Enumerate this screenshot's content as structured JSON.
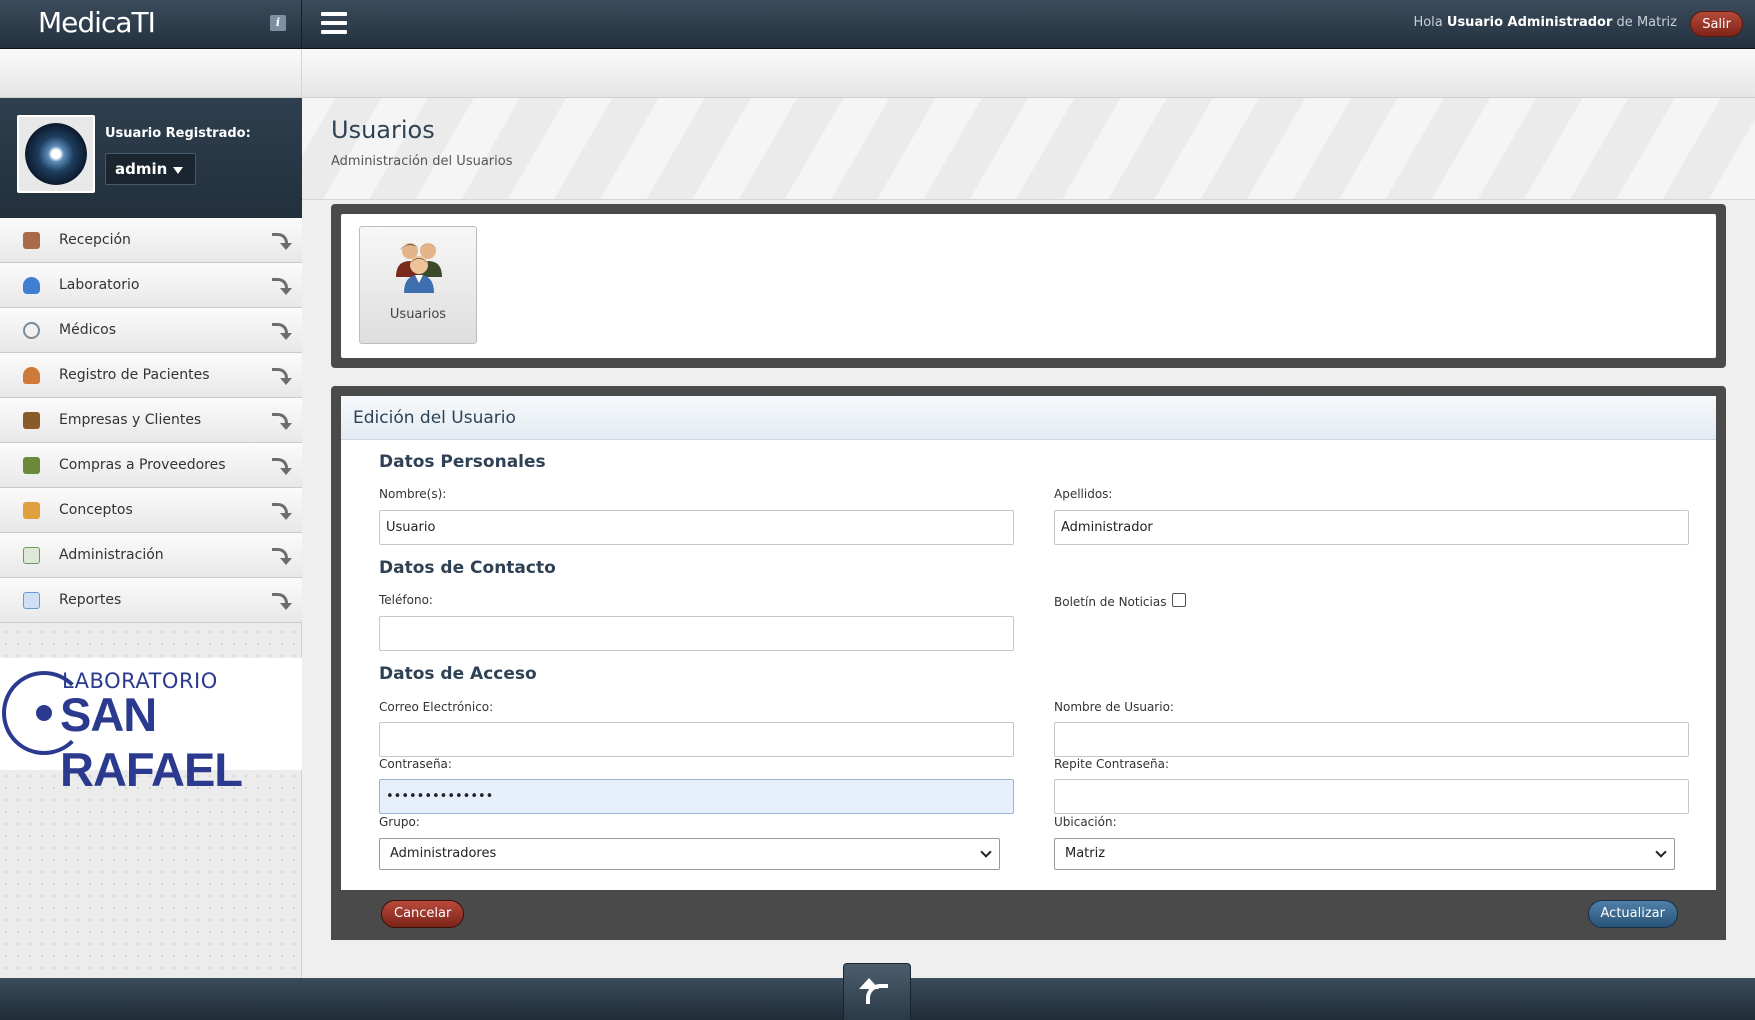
{
  "app": {
    "logo_text": "MedicaTI"
  },
  "topbar": {
    "greeting_prefix": "Hola",
    "user_name": "Usuario Administrador",
    "greeting_mid": "de",
    "location": "Matriz",
    "logout_label": "Salir"
  },
  "sidebar": {
    "user_label": "Usuario Registrado:",
    "user_value": "admin",
    "items": [
      {
        "label": "Recepción",
        "icon": "sofa-icon",
        "color": "#a86a4a"
      },
      {
        "label": "Laboratorio",
        "icon": "flask-icon",
        "color": "#3f7fd1"
      },
      {
        "label": "Médicos",
        "icon": "stethoscope-icon",
        "color": "#7a8a96"
      },
      {
        "label": "Registro de Pacientes",
        "icon": "patient-icon",
        "color": "#d07a3a"
      },
      {
        "label": "Empresas y Clientes",
        "icon": "building-icon",
        "color": "#8a5a2a"
      },
      {
        "label": "Compras a Proveedores",
        "icon": "supplier-icon",
        "color": "#6a8a3a"
      },
      {
        "label": "Conceptos",
        "icon": "box-icon",
        "color": "#e0a040"
      },
      {
        "label": "Administración",
        "icon": "admin-icon",
        "color": "#6a9a5a"
      },
      {
        "label": "Reportes",
        "icon": "report-icon",
        "color": "#6a9ad1"
      }
    ],
    "brand": {
      "line1": "LABORATORIO",
      "line2": "SAN RAFAEL"
    }
  },
  "page": {
    "title": "Usuarios",
    "subtitle": "Administración del Usuarios"
  },
  "apps": {
    "users_tile_label": "Usuarios"
  },
  "form": {
    "title": "Edición del Usuario",
    "sections": {
      "personal": "Datos Personales",
      "contact": "Datos de Contacto",
      "access": "Datos de Acceso"
    },
    "fields": {
      "first_name": {
        "label": "Nombre(s):",
        "value": "Usuario"
      },
      "last_name": {
        "label": "Apellidos:",
        "value": "Administrador"
      },
      "phone": {
        "label": "Teléfono:",
        "value": ""
      },
      "newsletter": {
        "label": "Boletín de Noticias",
        "checked": false
      },
      "email": {
        "label": "Correo Electrónico:",
        "value": ""
      },
      "username": {
        "label": "Nombre de Usuario:",
        "value": ""
      },
      "password": {
        "label": "Contraseña:",
        "value": "••••••••••••••"
      },
      "password_repeat": {
        "label": "Repite Contraseña:",
        "value": ""
      },
      "group": {
        "label": "Grupo:",
        "value": "Administradores"
      },
      "location": {
        "label": "Ubicación:",
        "value": "Matriz"
      }
    },
    "cancel_label": "Cancelar",
    "update_label": "Actualizar"
  },
  "colors": {
    "header_dark": "#2e3f4f",
    "accent_red": "#9a3528",
    "accent_blue": "#2f5f8a",
    "title_blue": "#2f4255"
  }
}
